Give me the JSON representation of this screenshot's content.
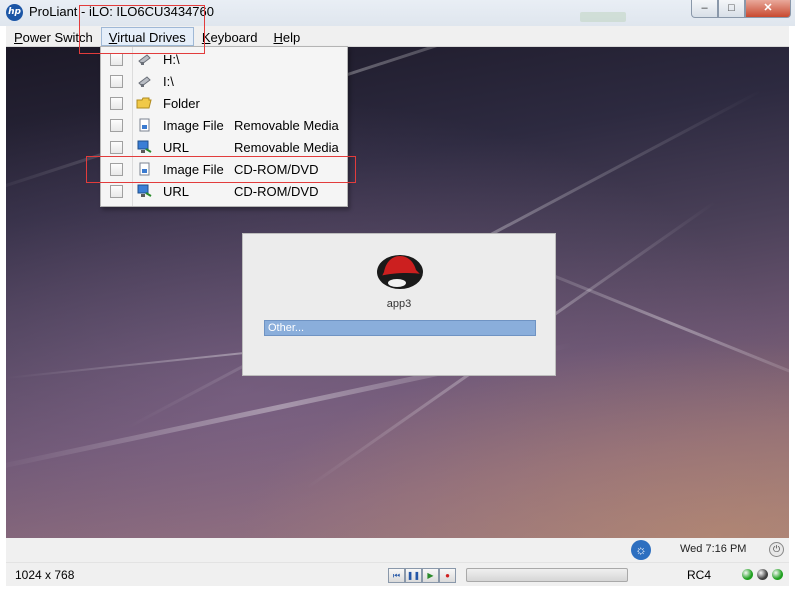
{
  "window": {
    "title": "ProLiant - iLO: ILO6CU3434760",
    "controls": {
      "minimize": "–",
      "maximize": "□",
      "close": "✕"
    },
    "logo_icon": "hp-logo-icon",
    "logo_text": "hp"
  },
  "menubar": {
    "items": [
      {
        "pre": "",
        "mnemonic": "P",
        "post": "ower Switch"
      },
      {
        "pre": "",
        "mnemonic": "V",
        "post": "irtual Drives"
      },
      {
        "pre": "",
        "mnemonic": "K",
        "post": "eyboard"
      },
      {
        "pre": "",
        "mnemonic": "H",
        "post": "elp"
      }
    ],
    "active_index": 1
  },
  "virtual_drives_menu": {
    "items": [
      {
        "label": "H:\\",
        "type": "",
        "icon": "usb-drive-icon",
        "checked": false
      },
      {
        "label": "I:\\",
        "type": "",
        "icon": "usb-drive-icon",
        "checked": false
      },
      {
        "label": "Folder",
        "type": "",
        "icon": "folder-icon",
        "checked": false
      },
      {
        "label": "Image File",
        "type": "Removable Media",
        "icon": "image-file-icon",
        "checked": false
      },
      {
        "label": "URL",
        "type": "Removable Media",
        "icon": "network-url-icon",
        "checked": false
      },
      {
        "label": "Image File",
        "type": "CD-ROM/DVD",
        "icon": "image-file-icon",
        "checked": false
      },
      {
        "label": "URL",
        "type": "CD-ROM/DVD",
        "icon": "network-url-icon",
        "checked": false
      }
    ]
  },
  "login_screen": {
    "hostname": "app3",
    "user_field": "Other...",
    "logo_icon": "redhat-logo-icon"
  },
  "top_panel": {
    "clock": "Wed  7:16 PM",
    "accessibility_icon": "accessibility-icon",
    "power_icon": "power-icon"
  },
  "status_bar": {
    "resolution": "1024 x 768",
    "encryption": "RC4",
    "media_buttons": [
      "rewind-icon",
      "pause-icon",
      "play-icon",
      "record-icon"
    ],
    "leds": [
      "#20a020",
      "#404040",
      "#20a020"
    ]
  },
  "colors": {
    "annotation": "#e23c3c",
    "login_field": "#8aaedb"
  }
}
